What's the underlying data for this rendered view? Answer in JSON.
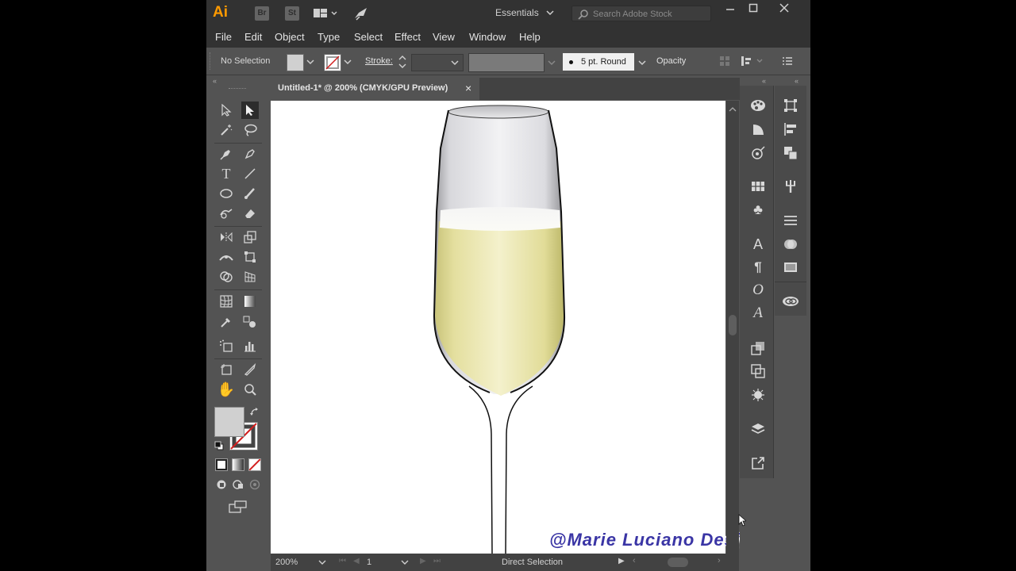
{
  "app": {
    "logo": "Ai",
    "bridge_label": "Br",
    "stock_label": "St",
    "workspace": "Essentials",
    "search_placeholder": "Search Adobe Stock"
  },
  "menu": [
    "File",
    "Edit",
    "Object",
    "Type",
    "Select",
    "Effect",
    "View",
    "Window",
    "Help"
  ],
  "control": {
    "selection": "No Selection",
    "stroke_label": "Stroke:",
    "brush": "5 pt. Round",
    "opacity_label": "Opacity"
  },
  "document": {
    "tab_title": "Untitled-1* @ 200% (CMYK/GPU Preview)",
    "close": "×"
  },
  "status": {
    "zoom": "200%",
    "artboard": "1",
    "mode": "Direct Selection"
  },
  "watermark": "@Marie Luciano Design",
  "colors": {
    "accent_logo": "#ff9a00",
    "ui_dark": "#323232",
    "ui_mid": "#535353",
    "champagne": "#e8e3a0",
    "watermark": "#3a35a5"
  }
}
